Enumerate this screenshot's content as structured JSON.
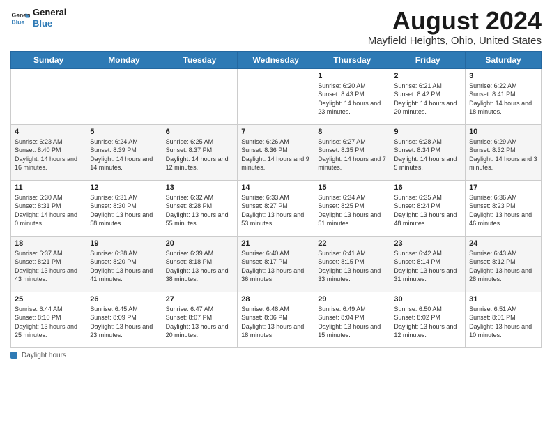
{
  "header": {
    "logo_line1": "General",
    "logo_line2": "Blue",
    "month_year": "August 2024",
    "location": "Mayfield Heights, Ohio, United States"
  },
  "days_of_week": [
    "Sunday",
    "Monday",
    "Tuesday",
    "Wednesday",
    "Thursday",
    "Friday",
    "Saturday"
  ],
  "weeks": [
    [
      {
        "day": "",
        "sunrise": "",
        "sunset": "",
        "daylight": ""
      },
      {
        "day": "",
        "sunrise": "",
        "sunset": "",
        "daylight": ""
      },
      {
        "day": "",
        "sunrise": "",
        "sunset": "",
        "daylight": ""
      },
      {
        "day": "",
        "sunrise": "",
        "sunset": "",
        "daylight": ""
      },
      {
        "day": "1",
        "sunrise": "Sunrise: 6:20 AM",
        "sunset": "Sunset: 8:43 PM",
        "daylight": "Daylight: 14 hours and 23 minutes."
      },
      {
        "day": "2",
        "sunrise": "Sunrise: 6:21 AM",
        "sunset": "Sunset: 8:42 PM",
        "daylight": "Daylight: 14 hours and 20 minutes."
      },
      {
        "day": "3",
        "sunrise": "Sunrise: 6:22 AM",
        "sunset": "Sunset: 8:41 PM",
        "daylight": "Daylight: 14 hours and 18 minutes."
      }
    ],
    [
      {
        "day": "4",
        "sunrise": "Sunrise: 6:23 AM",
        "sunset": "Sunset: 8:40 PM",
        "daylight": "Daylight: 14 hours and 16 minutes."
      },
      {
        "day": "5",
        "sunrise": "Sunrise: 6:24 AM",
        "sunset": "Sunset: 8:39 PM",
        "daylight": "Daylight: 14 hours and 14 minutes."
      },
      {
        "day": "6",
        "sunrise": "Sunrise: 6:25 AM",
        "sunset": "Sunset: 8:37 PM",
        "daylight": "Daylight: 14 hours and 12 minutes."
      },
      {
        "day": "7",
        "sunrise": "Sunrise: 6:26 AM",
        "sunset": "Sunset: 8:36 PM",
        "daylight": "Daylight: 14 hours and 9 minutes."
      },
      {
        "day": "8",
        "sunrise": "Sunrise: 6:27 AM",
        "sunset": "Sunset: 8:35 PM",
        "daylight": "Daylight: 14 hours and 7 minutes."
      },
      {
        "day": "9",
        "sunrise": "Sunrise: 6:28 AM",
        "sunset": "Sunset: 8:34 PM",
        "daylight": "Daylight: 14 hours and 5 minutes."
      },
      {
        "day": "10",
        "sunrise": "Sunrise: 6:29 AM",
        "sunset": "Sunset: 8:32 PM",
        "daylight": "Daylight: 14 hours and 3 minutes."
      }
    ],
    [
      {
        "day": "11",
        "sunrise": "Sunrise: 6:30 AM",
        "sunset": "Sunset: 8:31 PM",
        "daylight": "Daylight: 14 hours and 0 minutes."
      },
      {
        "day": "12",
        "sunrise": "Sunrise: 6:31 AM",
        "sunset": "Sunset: 8:30 PM",
        "daylight": "Daylight: 13 hours and 58 minutes."
      },
      {
        "day": "13",
        "sunrise": "Sunrise: 6:32 AM",
        "sunset": "Sunset: 8:28 PM",
        "daylight": "Daylight: 13 hours and 55 minutes."
      },
      {
        "day": "14",
        "sunrise": "Sunrise: 6:33 AM",
        "sunset": "Sunset: 8:27 PM",
        "daylight": "Daylight: 13 hours and 53 minutes."
      },
      {
        "day": "15",
        "sunrise": "Sunrise: 6:34 AM",
        "sunset": "Sunset: 8:25 PM",
        "daylight": "Daylight: 13 hours and 51 minutes."
      },
      {
        "day": "16",
        "sunrise": "Sunrise: 6:35 AM",
        "sunset": "Sunset: 8:24 PM",
        "daylight": "Daylight: 13 hours and 48 minutes."
      },
      {
        "day": "17",
        "sunrise": "Sunrise: 6:36 AM",
        "sunset": "Sunset: 8:23 PM",
        "daylight": "Daylight: 13 hours and 46 minutes."
      }
    ],
    [
      {
        "day": "18",
        "sunrise": "Sunrise: 6:37 AM",
        "sunset": "Sunset: 8:21 PM",
        "daylight": "Daylight: 13 hours and 43 minutes."
      },
      {
        "day": "19",
        "sunrise": "Sunrise: 6:38 AM",
        "sunset": "Sunset: 8:20 PM",
        "daylight": "Daylight: 13 hours and 41 minutes."
      },
      {
        "day": "20",
        "sunrise": "Sunrise: 6:39 AM",
        "sunset": "Sunset: 8:18 PM",
        "daylight": "Daylight: 13 hours and 38 minutes."
      },
      {
        "day": "21",
        "sunrise": "Sunrise: 6:40 AM",
        "sunset": "Sunset: 8:17 PM",
        "daylight": "Daylight: 13 hours and 36 minutes."
      },
      {
        "day": "22",
        "sunrise": "Sunrise: 6:41 AM",
        "sunset": "Sunset: 8:15 PM",
        "daylight": "Daylight: 13 hours and 33 minutes."
      },
      {
        "day": "23",
        "sunrise": "Sunrise: 6:42 AM",
        "sunset": "Sunset: 8:14 PM",
        "daylight": "Daylight: 13 hours and 31 minutes."
      },
      {
        "day": "24",
        "sunrise": "Sunrise: 6:43 AM",
        "sunset": "Sunset: 8:12 PM",
        "daylight": "Daylight: 13 hours and 28 minutes."
      }
    ],
    [
      {
        "day": "25",
        "sunrise": "Sunrise: 6:44 AM",
        "sunset": "Sunset: 8:10 PM",
        "daylight": "Daylight: 13 hours and 25 minutes."
      },
      {
        "day": "26",
        "sunrise": "Sunrise: 6:45 AM",
        "sunset": "Sunset: 8:09 PM",
        "daylight": "Daylight: 13 hours and 23 minutes."
      },
      {
        "day": "27",
        "sunrise": "Sunrise: 6:47 AM",
        "sunset": "Sunset: 8:07 PM",
        "daylight": "Daylight: 13 hours and 20 minutes."
      },
      {
        "day": "28",
        "sunrise": "Sunrise: 6:48 AM",
        "sunset": "Sunset: 8:06 PM",
        "daylight": "Daylight: 13 hours and 18 minutes."
      },
      {
        "day": "29",
        "sunrise": "Sunrise: 6:49 AM",
        "sunset": "Sunset: 8:04 PM",
        "daylight": "Daylight: 13 hours and 15 minutes."
      },
      {
        "day": "30",
        "sunrise": "Sunrise: 6:50 AM",
        "sunset": "Sunset: 8:02 PM",
        "daylight": "Daylight: 13 hours and 12 minutes."
      },
      {
        "day": "31",
        "sunrise": "Sunrise: 6:51 AM",
        "sunset": "Sunset: 8:01 PM",
        "daylight": "Daylight: 13 hours and 10 minutes."
      }
    ]
  ],
  "footer": {
    "daylight_label": "Daylight hours"
  },
  "colors": {
    "header_bg": "#2e7ab5",
    "accent": "#2e7ab5"
  }
}
